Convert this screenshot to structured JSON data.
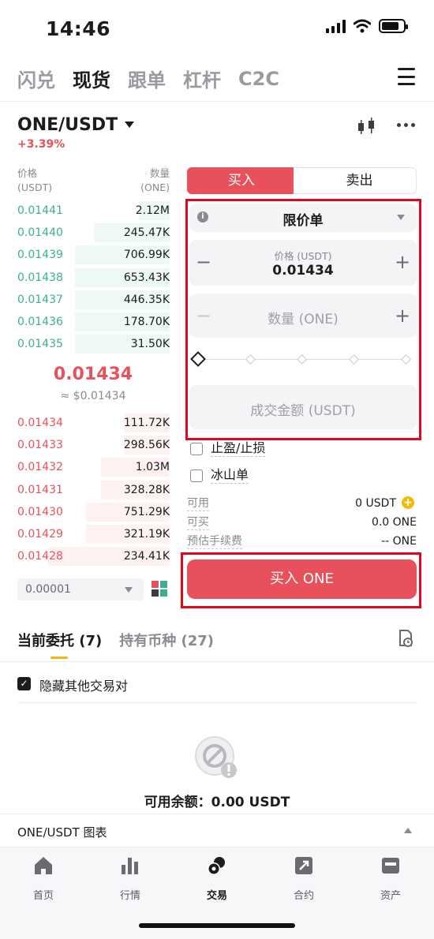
{
  "status_bar": {
    "time": "14:46"
  },
  "top_nav": {
    "tabs": [
      {
        "label": "闪兑",
        "active": false
      },
      {
        "label": "现货",
        "active": true
      },
      {
        "label": "跟单",
        "active": false
      },
      {
        "label": "杠杆",
        "active": false
      },
      {
        "label": "C2C",
        "active": false
      }
    ]
  },
  "pair": {
    "name": "ONE/USDT",
    "change": "+3.39%"
  },
  "order_book": {
    "price_header": "价格",
    "price_unit": "(USDT)",
    "qty_header": "数量",
    "qty_unit": "(ONE)",
    "bids": [
      {
        "price": "0.01441",
        "qty": "2.12M",
        "depth": 0.2
      },
      {
        "price": "0.01440",
        "qty": "245.47K",
        "depth": 0.5
      },
      {
        "price": "0.01439",
        "qty": "706.99K",
        "depth": 0.62
      },
      {
        "price": "0.01438",
        "qty": "653.43K",
        "depth": 0.62
      },
      {
        "price": "0.01437",
        "qty": "446.35K",
        "depth": 0.62
      },
      {
        "price": "0.01436",
        "qty": "178.70K",
        "depth": 0.62
      },
      {
        "price": "0.01435",
        "qty": "31.50K",
        "depth": 0.62
      }
    ],
    "last_price": "0.01434",
    "last_price_usd": "≈ $0.01434",
    "asks": [
      {
        "price": "0.01434",
        "qty": "111.72K",
        "depth": 0.3
      },
      {
        "price": "0.01433",
        "qty": "298.56K",
        "depth": 0.3
      },
      {
        "price": "0.01432",
        "qty": "1.03M",
        "depth": 0.45
      },
      {
        "price": "0.01431",
        "qty": "328.28K",
        "depth": 0.45
      },
      {
        "price": "0.01430",
        "qty": "751.29K",
        "depth": 0.55
      },
      {
        "price": "0.01429",
        "qty": "321.19K",
        "depth": 0.55
      },
      {
        "price": "0.01428",
        "qty": "234.41K",
        "depth": 0.8
      }
    ],
    "precision": "0.00001"
  },
  "order_form": {
    "buy_tab": "买入",
    "sell_tab": "卖出",
    "order_type": "限价单",
    "price_label": "价格 (USDT)",
    "price_value": "0.01434",
    "qty_placeholder": "数量 (ONE)",
    "slider_percent": 0,
    "amount_placeholder": "成交金额 (USDT)",
    "tp_sl_label": "止盈/止损",
    "iceberg_label": "冰山单",
    "available_label": "可用",
    "available_value": "0 USDT",
    "can_buy_label": "可买",
    "can_buy_value": "0.0 ONE",
    "fee_label": "预估手续费",
    "fee_value": "-- ONE",
    "buy_button": "买入 ONE"
  },
  "orders": {
    "tabs": [
      {
        "label": "当前委托 (7)",
        "active": true
      },
      {
        "label": "持有币种 (27)",
        "active": false
      }
    ],
    "hide_other_pairs": "隐藏其他交易对",
    "balance": "可用余额：0.00 USDT",
    "chart_label": "ONE/USDT 图表"
  },
  "bottom_nav": {
    "items": [
      {
        "label": "首页",
        "icon": "home-icon",
        "active": false
      },
      {
        "label": "行情",
        "icon": "market-icon",
        "active": false
      },
      {
        "label": "交易",
        "icon": "trade-icon",
        "active": true
      },
      {
        "label": "合约",
        "icon": "contract-icon",
        "active": false
      },
      {
        "label": "资产",
        "icon": "wallet-icon",
        "active": false
      }
    ]
  },
  "colors": {
    "buy": "#e8505b",
    "bid": "#3bb08f",
    "accent": "#f0b90b",
    "highlight": "#e3071b"
  }
}
